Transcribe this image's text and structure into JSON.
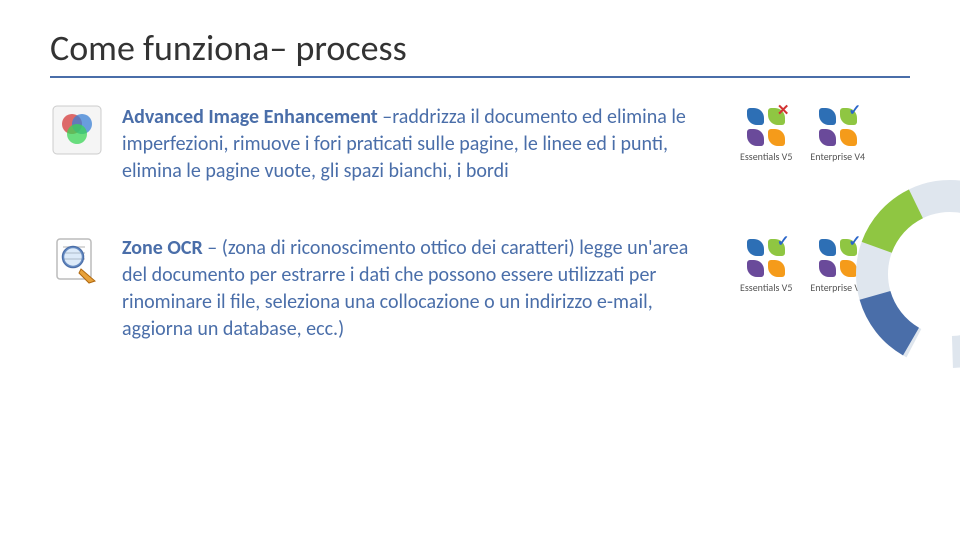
{
  "title": "Come funziona– process",
  "features": [
    {
      "heading": "Advanced Image Enhancement",
      "body": " –raddrizza il documento ed elimina le imperfezioni, rimuove i fori praticati sulle pagine, le linee ed i punti, elimina le pagine vuote, gli spazi bianchi, i bordi"
    },
    {
      "heading": "Zone OCR",
      "body": " – (zona di riconoscimento ottico dei caratteri) legge un'area del documento per estrarre i dati che possono essere utilizzati per rinominare il file, seleziona una collocazione o un indirizzo e-mail, aggiorna un database, ecc.)"
    }
  ],
  "badges": {
    "essentials": "Essentials V5",
    "enterprise": "Enterprise V4"
  },
  "marks": {
    "cross": "✕",
    "check": "✓"
  },
  "colors": {
    "accent": "#4a6ea9",
    "blade1": "#2d6fb5",
    "blade2": "#8fc642",
    "blade3": "#f59b1a",
    "blade4": "#6a4a9a",
    "cross": "#d23333",
    "check": "#2a65c9"
  }
}
